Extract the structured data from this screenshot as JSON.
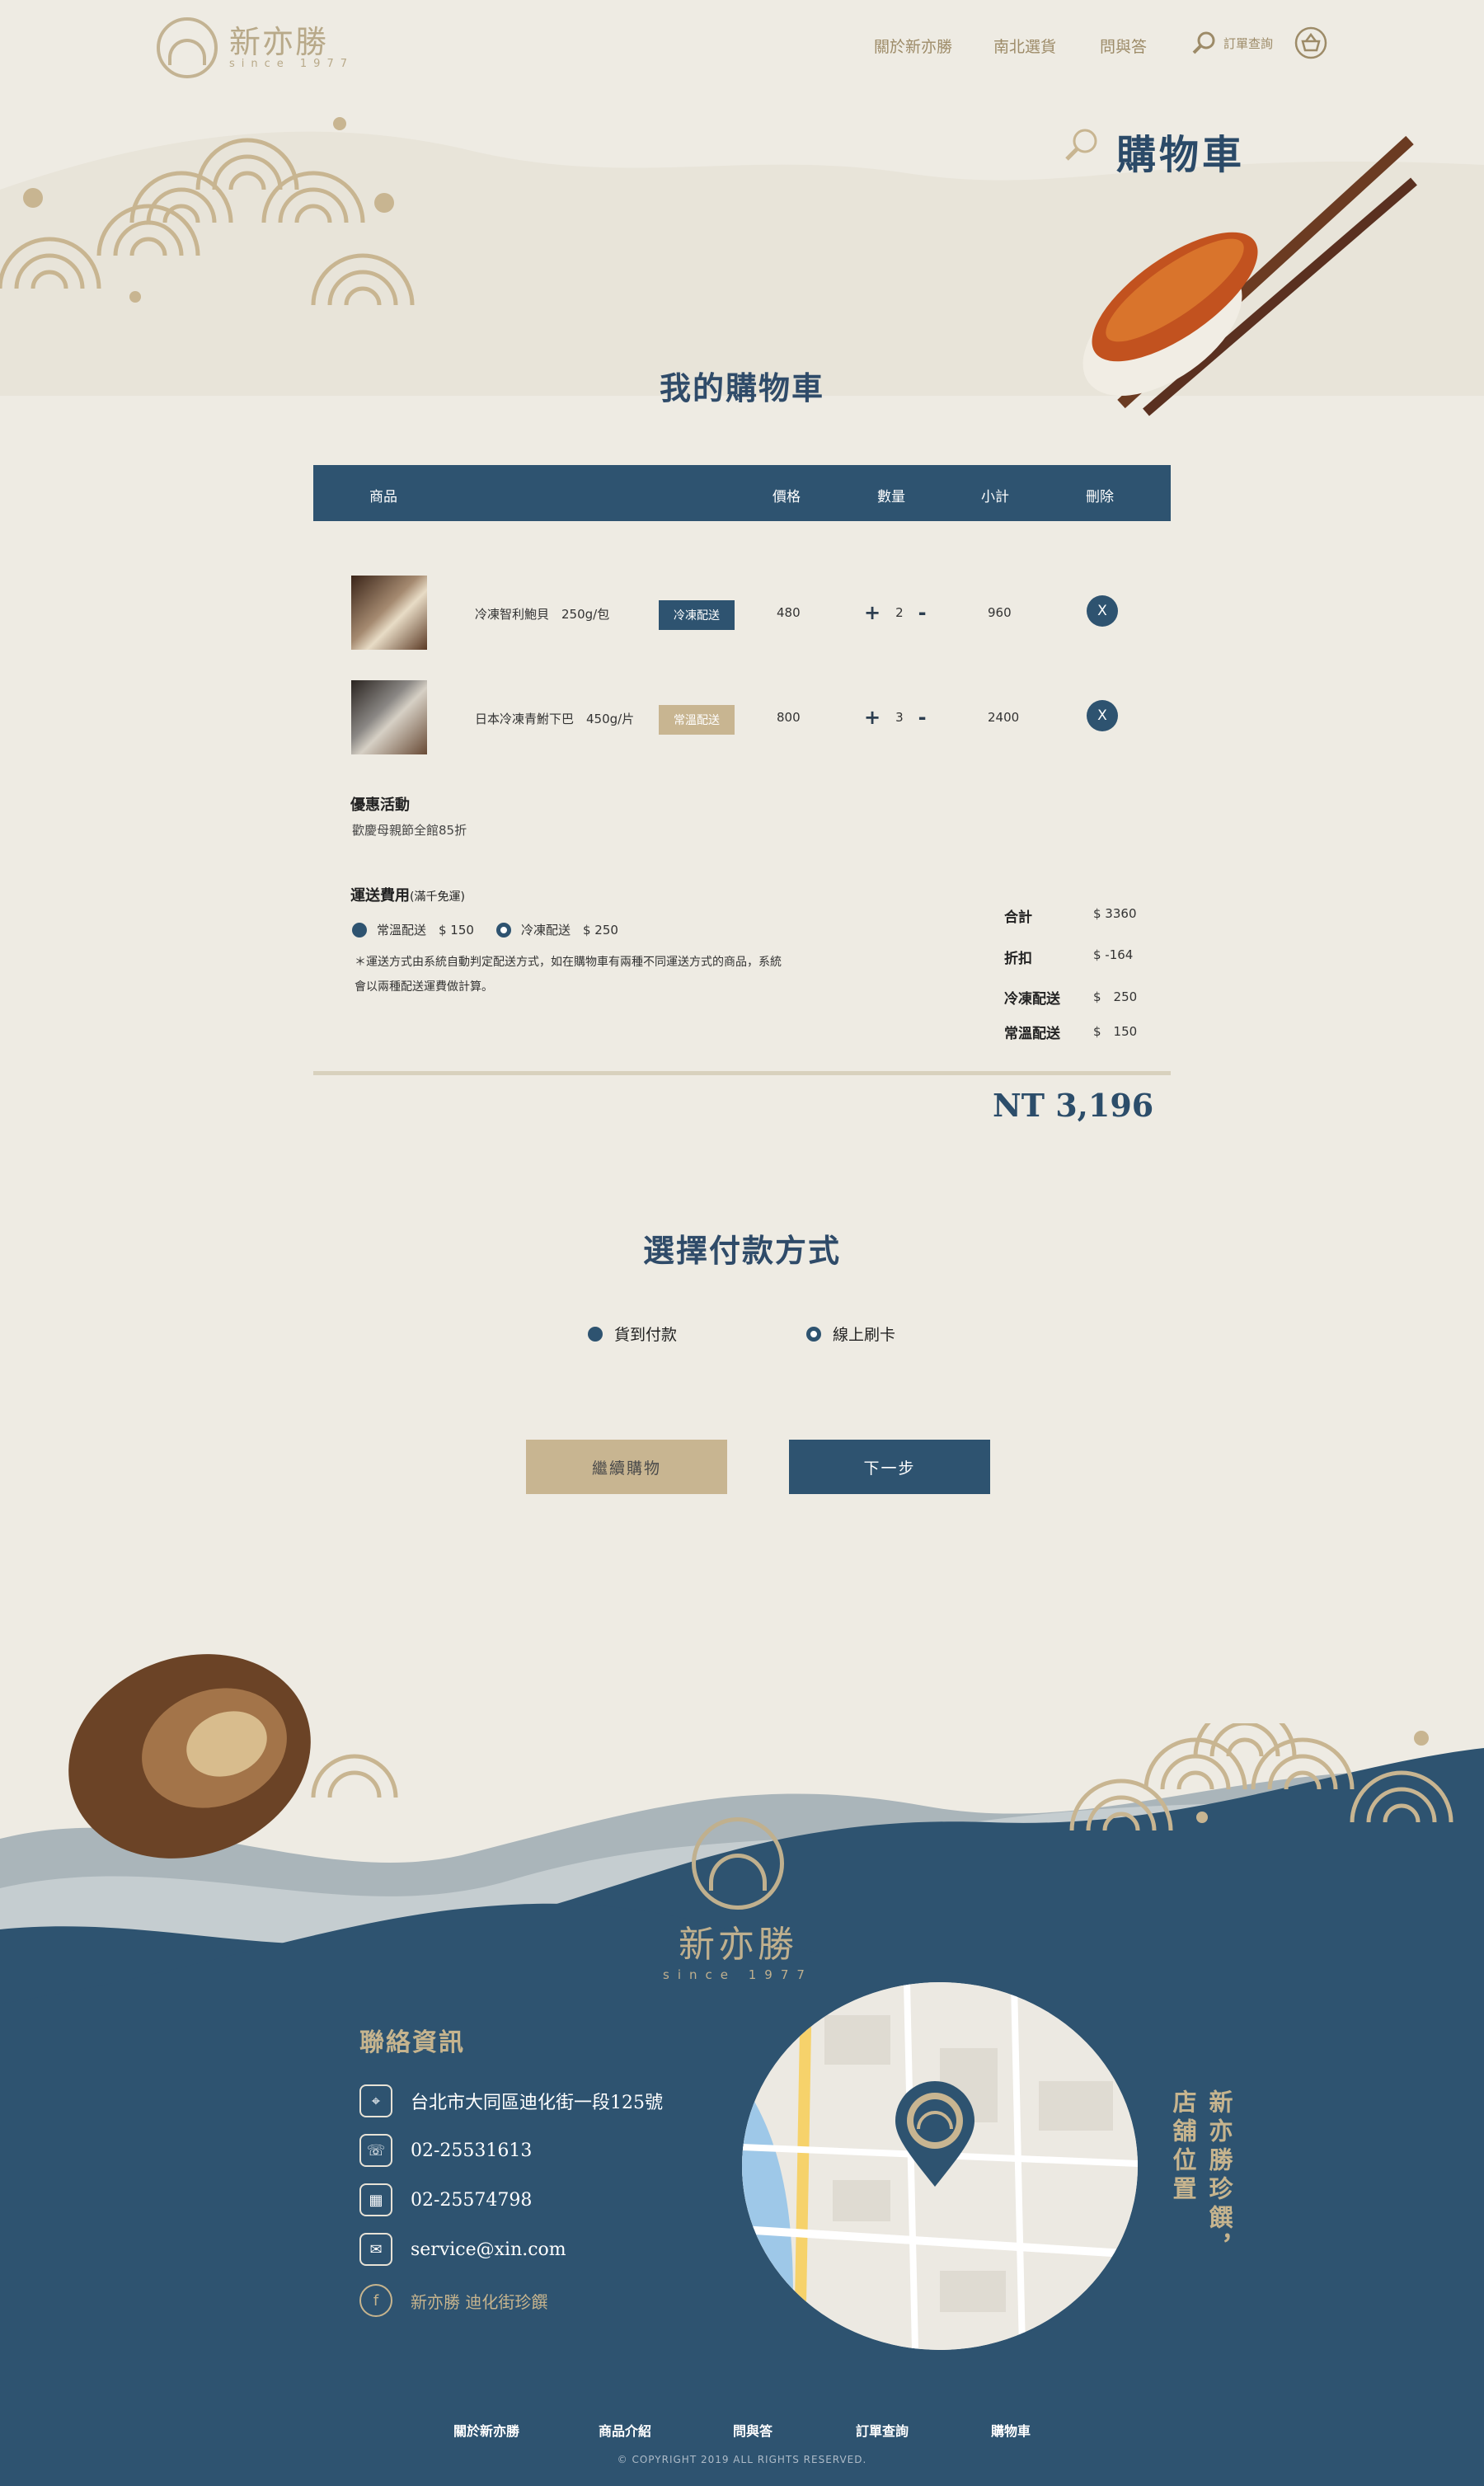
{
  "brand": {
    "name": "新亦勝",
    "since": "since 1977"
  },
  "nav": {
    "about": "關於新亦勝",
    "products": "南北選貨",
    "faq": "問與答",
    "order_query": "訂單查詢"
  },
  "page_title": "購物車",
  "cart": {
    "heading": "我的購物車",
    "columns": {
      "product": "商品",
      "price": "價格",
      "qty": "數量",
      "subtotal": "小計",
      "delete": "刪除"
    },
    "items": [
      {
        "name": "冷凍智利鮑貝　250g/包",
        "tag": "冷凍配送",
        "price": "480",
        "qty": "2",
        "subtotal": "960",
        "delete": "X"
      },
      {
        "name": "日本冷凍青鮒下巴　450g/片",
        "tag": "常溫配送",
        "price": "800",
        "qty": "3",
        "subtotal": "2400",
        "delete": "X"
      }
    ],
    "qty_plus": "+",
    "qty_minus": "-"
  },
  "promo": {
    "title": "優惠活動",
    "text": "歡慶母親節全館85折"
  },
  "shipping": {
    "title": "運送費用",
    "title_note": "(滿千免運)",
    "options": [
      {
        "label": "常溫配送　$ 150"
      },
      {
        "label": "冷凍配送　$ 250"
      }
    ],
    "note": "＊運送方式由系統自動判定配送方式，如在購物車有兩種不同運送方式的商品，系統會以兩種配送運費做計算。"
  },
  "summary": {
    "rows": [
      {
        "label": "合計",
        "value": "$ 3360"
      },
      {
        "label": "折扣",
        "value": "$ -164"
      },
      {
        "label": "冷凍配送",
        "value": "$　250"
      },
      {
        "label": "常溫配送",
        "value": "$　150"
      }
    ],
    "total": "NT 3,196"
  },
  "payment": {
    "heading": "選擇付款方式",
    "options": [
      {
        "label": "貨到付款"
      },
      {
        "label": "線上刷卡"
      }
    ]
  },
  "buttons": {
    "continue": "繼續購物",
    "next": "下一步"
  },
  "footer": {
    "contact_title": "聯絡資訊",
    "address": "台北市大同區迪化街一段125號",
    "phone": "02-25531613",
    "fax": "02-25574798",
    "email": "service@xin.com",
    "facebook": "新亦勝 迪化街珍饌",
    "location_line1": "新亦勝珍饌，",
    "location_line2": "店舖位置",
    "nav": [
      "關於新亦勝",
      "商品介紹",
      "問與答",
      "訂單查詢",
      "購物車"
    ],
    "copyright": "© COPYRIGHT 2019 ALL RIGHTS RESERVED."
  },
  "colors": {
    "navy": "#2e5370",
    "gold": "#c8b591",
    "paper": "#eeebe3"
  }
}
